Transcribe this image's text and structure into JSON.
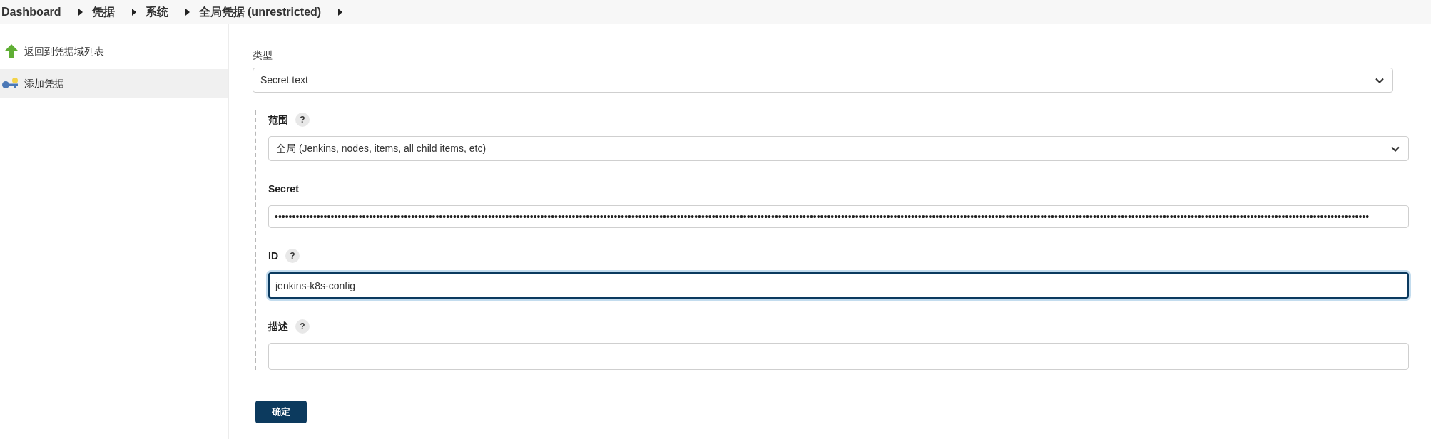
{
  "breadcrumb": [
    {
      "label": "Dashboard"
    },
    {
      "label": "凭据"
    },
    {
      "label": "系统"
    },
    {
      "label": "全局凭据 (unrestricted)"
    }
  ],
  "sidebar": {
    "items": [
      {
        "kind": "back",
        "label": "返回到凭据域列表",
        "selected": false
      },
      {
        "kind": "add",
        "label": "添加凭据",
        "selected": true
      }
    ]
  },
  "form": {
    "type_field": {
      "label": "类型",
      "value": "Secret text"
    },
    "fields": [
      {
        "kind": "select",
        "label": "范围",
        "help": "?",
        "value": "全局 (Jenkins, nodes, items, all child items, etc)",
        "focused": false
      },
      {
        "kind": "password",
        "label": "Secret",
        "value": "•••••••••••••••••••••••••••••••••••••••••••••••••••••••••••••••••••••••••••••••••••••••••••••••••••••••••••••••••••••••••••••••••••••••••••••••••••••••••••••••••••••••••••••••••••••••••••••••••••••••••••••••••••••••••••••••••••••••••••••••••••••••••••••••••••••••••••••••••••••••••••••••••••••••••••••••••••••••••",
        "focused": false
      },
      {
        "kind": "text",
        "label": "ID",
        "help": "?",
        "value": "jenkins-k8s-config",
        "focused": true
      },
      {
        "kind": "textarea",
        "label": "描述",
        "help": "?",
        "focused": false
      }
    ],
    "submit": "确定"
  }
}
